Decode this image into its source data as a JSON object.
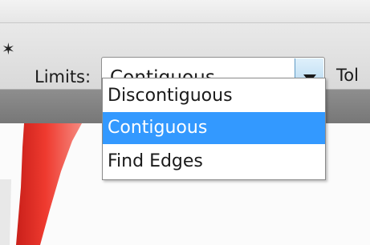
{
  "options_bar": {
    "tool_icon": "magic-wand-icon",
    "limits_label": "Limits:",
    "limits_value": "Contiguous",
    "tolerance_label": "Tol"
  },
  "dropdown": {
    "options": [
      {
        "label": "Discontiguous",
        "selected": false
      },
      {
        "label": "Contiguous",
        "selected": true
      },
      {
        "label": "Find Edges",
        "selected": false
      }
    ]
  },
  "colors": {
    "selection": "#3399ff",
    "arrow_button": "#a9d2ee",
    "canvas_stroke": "#e53228"
  }
}
